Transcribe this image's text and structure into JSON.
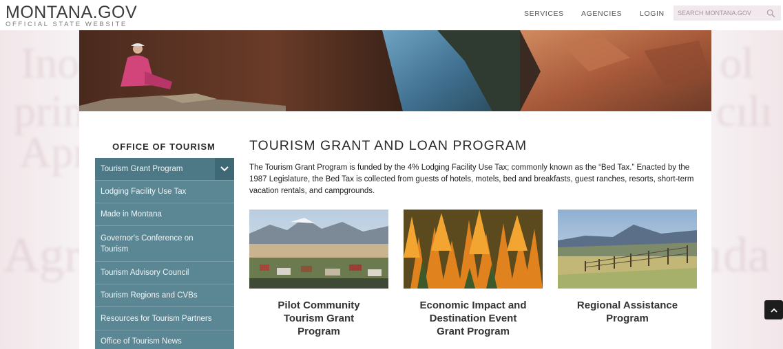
{
  "header": {
    "logo_main": "MONTANA.GOV",
    "logo_sub": "OFFICIAL STATE WEBSITE",
    "nav": [
      "SERVICES",
      "AGENCIES",
      "LOGIN"
    ],
    "search_placeholder": "SEARCH MONTANA.GOV",
    "search_icon": "search-icon"
  },
  "sidebar": {
    "title": "OFFICE OF TOURISM",
    "items": [
      {
        "label": "Tourism Grant Program",
        "active": true
      },
      {
        "label": "Lodging Facility Use Tax"
      },
      {
        "label": "Made in Montana"
      },
      {
        "label": "Governor's Conference on Tourism"
      },
      {
        "label": "Tourism Advisory Council"
      },
      {
        "label": "Tourism Regions and CVBs"
      },
      {
        "label": "Resources for Tourism Partners"
      },
      {
        "label": "Office of Tourism News"
      }
    ]
  },
  "main": {
    "title": "TOURISM GRANT AND LOAN PROGRAM",
    "intro": "The Tourism Grant Program is funded by the 4% Lodging Facility Use Tax; commonly known as the “Bed Tax.” Enacted by the 1987 Legislature, the Bed Tax is collected from guests of hotels, motels, bed and breakfasts, guest ranches, resorts, short-term vacation rentals, and campgrounds.",
    "cards": [
      {
        "title": "Pilot Community Tourism Grant Program"
      },
      {
        "title": "Economic Impact and Destination Event Grant Program"
      },
      {
        "title": "Regional Assistance Program"
      }
    ]
  },
  "colors": {
    "sidebar_bg": "#5b8795",
    "sidebar_active": "#4d7886",
    "chevron_bg": "#3f6875"
  }
}
